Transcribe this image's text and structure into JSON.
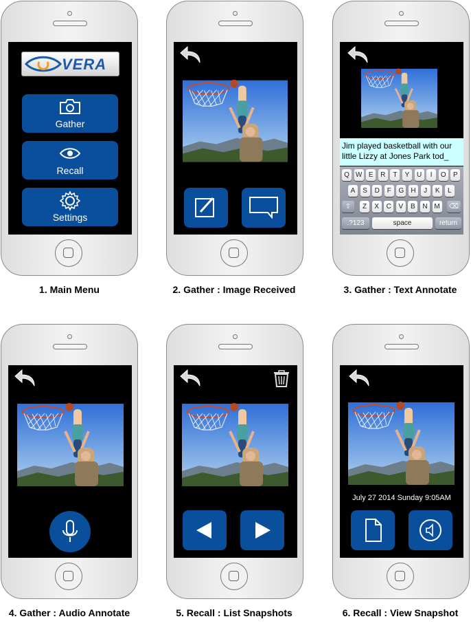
{
  "captions": [
    "1. Main Menu",
    "2. Gather : Image Received",
    "3. Gather : Text Annotate",
    "4. Gather : Audio Annotate",
    "5. Recall : List Snapshots",
    "6. Recall : View Snapshot"
  ],
  "main_menu": {
    "logo_text": "VERA",
    "buttons": [
      {
        "label": "Gather",
        "icon": "camera-icon"
      },
      {
        "label": "Recall",
        "icon": "eye-icon"
      },
      {
        "label": "Settings",
        "icon": "gear-icon"
      }
    ]
  },
  "text_annotate": {
    "annotation_text": "Jim played basketball with our little Lizzy at Jones Park tod_",
    "keyboard": {
      "row1": [
        "Q",
        "W",
        "E",
        "R",
        "T",
        "Y",
        "U",
        "I",
        "O",
        "P"
      ],
      "row2": [
        "A",
        "S",
        "D",
        "F",
        "G",
        "H",
        "J",
        "K",
        "L"
      ],
      "row3": [
        "Z",
        "X",
        "C",
        "V",
        "B",
        "N",
        "M"
      ],
      "numbers_key": ".?123",
      "space_key": "space",
      "return_key": "return"
    }
  },
  "view_snapshot": {
    "timestamp": "July 27 2014 Sunday 9:05AM"
  },
  "colors": {
    "button_blue": "#0a4f9c",
    "annotation_bg": "#ccffff",
    "screen_bg": "#000000"
  }
}
